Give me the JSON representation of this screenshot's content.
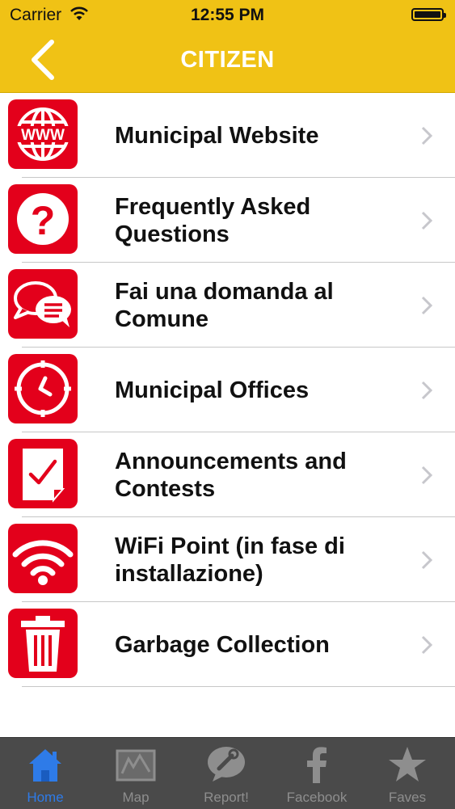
{
  "status_bar": {
    "carrier": "Carrier",
    "time": "12:55 PM"
  },
  "nav": {
    "title": "CITIZEN"
  },
  "menu": [
    {
      "label": "Municipal Website",
      "icon": "globe-www-icon"
    },
    {
      "label": "Frequently Asked Questions",
      "icon": "question-mark-icon"
    },
    {
      "label": "Fai una domanda al Comune",
      "icon": "chat-bubbles-icon"
    },
    {
      "label": "Municipal Offices",
      "icon": "clock-icon"
    },
    {
      "label": "Announcements and Contests",
      "icon": "document-check-icon"
    },
    {
      "label": "WiFi Point (in fase di installazione)",
      "icon": "wifi-icon"
    },
    {
      "label": "Garbage Collection",
      "icon": "trash-bin-icon"
    }
  ],
  "tabs": [
    {
      "label": "Home",
      "icon": "home-icon",
      "active": true
    },
    {
      "label": "Map",
      "icon": "map-icon"
    },
    {
      "label": "Report!",
      "icon": "report-wrench-icon"
    },
    {
      "label": "Facebook",
      "icon": "facebook-icon"
    },
    {
      "label": "Faves",
      "icon": "star-icon"
    }
  ],
  "colors": {
    "header": "#f0c215",
    "icon_bg": "#e3001b",
    "tabbar": "#4a4a4a",
    "tab_active": "#2e7be8",
    "tab_inactive": "#8e8e8e"
  }
}
